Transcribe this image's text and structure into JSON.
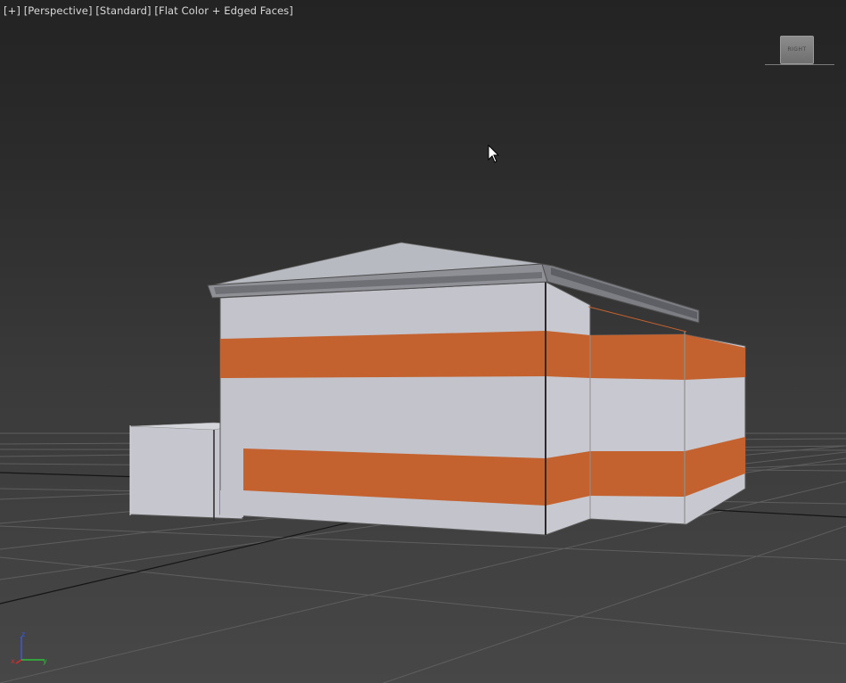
{
  "viewport": {
    "label_parts": [
      "[+]",
      "[Perspective]",
      "[Standard]",
      "[Flat Color + Edged Faces]"
    ],
    "view_type": "Perspective",
    "shading_mode": "Flat Color + Edged Faces"
  },
  "viewcube": {
    "face_label": "RIGHT"
  },
  "axis_gizmo": {
    "x_label": "x",
    "y_label": "y",
    "z_label": "z",
    "x_color": "#d62b2b",
    "y_color": "#2fbf3a",
    "z_color": "#3b57e6"
  },
  "colors": {
    "wall": "#c4c5cc",
    "stripe": "#c4622f",
    "roof": "#b9bbc2",
    "grid": "#5c5c5c",
    "grid_axis": "#111111"
  }
}
